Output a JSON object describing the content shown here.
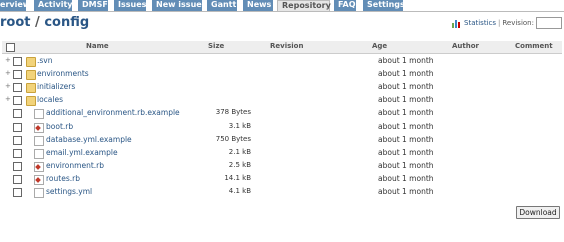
{
  "tabs": [
    {
      "label": "Overview",
      "selected": false
    },
    {
      "label": "Activity",
      "selected": false
    },
    {
      "label": "DMSF",
      "selected": false
    },
    {
      "label": "Issues",
      "selected": false
    },
    {
      "label": "New issue",
      "selected": false
    },
    {
      "label": "Gantt",
      "selected": false
    },
    {
      "label": "News",
      "selected": false
    },
    {
      "label": "Repository",
      "selected": true
    },
    {
      "label": "FAQ",
      "selected": false
    },
    {
      "label": "Settings",
      "selected": false
    }
  ],
  "breadcrumb": {
    "root": "root",
    "sep": "/",
    "current": "config"
  },
  "statistics_label": "Statistics",
  "revision_label": "Revision:",
  "columns": {
    "name": "Name",
    "size": "Size",
    "revision": "Revision",
    "age": "Age",
    "author": "Author",
    "comment": "Comment"
  },
  "entries": [
    {
      "name": ".svn",
      "type": "folder",
      "size": "",
      "age": "about 1 month"
    },
    {
      "name": "environments",
      "type": "folder",
      "size": "",
      "age": "about 1 month"
    },
    {
      "name": "initializers",
      "type": "folder",
      "size": "",
      "age": "about 1 month"
    },
    {
      "name": "locales",
      "type": "folder",
      "size": "",
      "age": "about 1 month"
    },
    {
      "name": "additional_environment.rb.example",
      "type": "file",
      "size": "378 Bytes",
      "age": "about 1 month"
    },
    {
      "name": "boot.rb",
      "type": "ruby",
      "size": "3.1 kB",
      "age": "about 1 month"
    },
    {
      "name": "database.yml.example",
      "type": "file",
      "size": "750 Bytes",
      "age": "about 1 month"
    },
    {
      "name": "email.yml.example",
      "type": "file",
      "size": "2.1 kB",
      "age": "about 1 month"
    },
    {
      "name": "environment.rb",
      "type": "ruby",
      "size": "2.5 kB",
      "age": "about 1 month"
    },
    {
      "name": "routes.rb",
      "type": "ruby",
      "size": "14.1 kB",
      "age": "about 1 month"
    },
    {
      "name": "settings.yml",
      "type": "file",
      "size": "4.1 kB",
      "age": "about 1 month"
    }
  ],
  "download_label": "Download",
  "colors": {
    "tab_bg": "#628DB6",
    "link": "#2A5685"
  }
}
